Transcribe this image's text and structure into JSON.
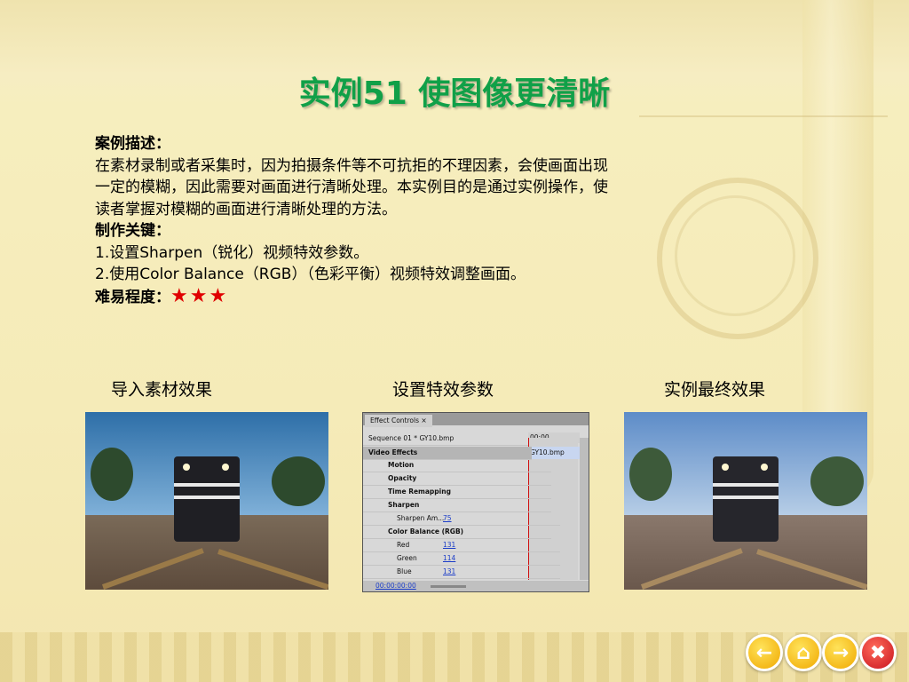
{
  "slide": {
    "title": "实例51  使图像更清晰",
    "description_heading": "案例描述：",
    "description_line1": "在素材录制或者采集时，因为拍摄条件等不可抗拒的不理因素，会使画面出现",
    "description_line2": "一定的模糊，因此需要对画面进行清晰处理。本实例目的是通过实例操作，使",
    "description_line3": "读者掌握对模糊的画面进行清晰处理的方法。",
    "key_heading": "制作关键：",
    "key_item1": "1.设置Sharpen（锐化）视频特效参数。",
    "key_item2": "2.使用Color Balance（RGB）（色彩平衡）视频特效调整画面。",
    "difficulty_label": "难易程度：",
    "difficulty_stars": "★★★"
  },
  "captions": {
    "left": "导入素材效果",
    "middle": "设置特效参数",
    "right": "实例最终效果"
  },
  "effect_controls": {
    "tab": "Effect Controls ×",
    "sequence": "Sequence 01 * GY10.bmp",
    "timecode_top": "00:00",
    "clip": "GY10.bmp",
    "section": "Video Effects",
    "rows": {
      "motion": "Motion",
      "opacity": "Opacity",
      "time_remapping": "Time Remapping",
      "sharpen": "Sharpen",
      "sharpen_amount_label": "Sharpen Am...",
      "sharpen_amount_value": "75",
      "color_balance": "Color Balance (RGB)",
      "red_label": "Red",
      "red_value": "131",
      "green_label": "Green",
      "green_value": "114",
      "blue_label": "Blue",
      "blue_value": "131"
    },
    "timecode_bottom": "00:00:00:00"
  },
  "nav": {
    "prev_icon": "arrow-left-icon",
    "home_icon": "home-icon",
    "next_icon": "arrow-right-icon",
    "close_icon": "close-icon"
  },
  "colors": {
    "title": "#10a048",
    "stars": "#e00000",
    "nav_yellow": "#f0a800",
    "nav_red": "#c8141e"
  }
}
